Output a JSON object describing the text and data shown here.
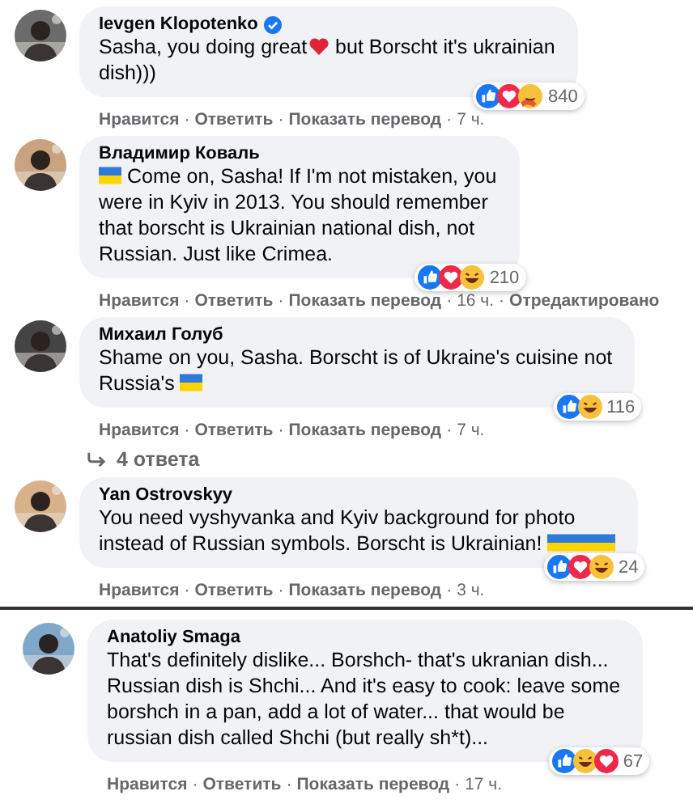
{
  "separator": "·",
  "comments": [
    {
      "author": "Ievgen Klopotenko",
      "verified": true,
      "lines": [
        [
          {
            "kind": "text",
            "text": "Sasha, you doing great"
          },
          {
            "kind": "heart"
          },
          {
            "kind": "text",
            "text": " but Borscht it's ukrainian"
          }
        ],
        [
          {
            "kind": "text",
            "text": "dish)))"
          }
        ]
      ],
      "actions": [
        "Нравится",
        "Ответить",
        "Показать перевод"
      ],
      "time": "7 ч.",
      "reactions": [
        {
          "kind": "like"
        },
        {
          "kind": "love"
        },
        {
          "kind": "care"
        }
      ],
      "reaction_count": "840"
    },
    {
      "author": "Владимир Коваль",
      "verified": false,
      "lines": [
        [
          {
            "kind": "flag"
          },
          {
            "kind": "text",
            "text": " Come on, Sasha! If I'm not mistaken, you"
          }
        ],
        [
          {
            "kind": "text",
            "text": "were in Kyiv in 2013. You should remember"
          }
        ],
        [
          {
            "kind": "text",
            "text": "that borscht is Ukrainian national dish, not"
          }
        ],
        [
          {
            "kind": "text",
            "text": "Russian. Just like Crimea."
          }
        ]
      ],
      "actions": [
        "Нравится",
        "Ответить",
        "Показать перевод"
      ],
      "time": "16 ч.",
      "edited": "Отредактировано",
      "reactions": [
        {
          "kind": "like"
        },
        {
          "kind": "love"
        },
        {
          "kind": "haha"
        }
      ],
      "reaction_count": "210"
    },
    {
      "author": "Михаил Голуб",
      "verified": false,
      "lines": [
        [
          {
            "kind": "text",
            "text": "Shame on you, Sasha. Borscht is of Ukraine's cuisine not"
          }
        ],
        [
          {
            "kind": "text",
            "text": "Russia's "
          },
          {
            "kind": "flag"
          }
        ]
      ],
      "actions": [
        "Нравится",
        "Ответить",
        "Показать перевод"
      ],
      "time": "7 ч.",
      "reactions": [
        {
          "kind": "like"
        },
        {
          "kind": "haha"
        }
      ],
      "reaction_count": "116",
      "replies": "4 ответа"
    },
    {
      "author": "Yan Ostrovskyy",
      "verified": false,
      "lines": [
        [
          {
            "kind": "text",
            "text": "You need vyshyvanka and Kyiv background for photo"
          }
        ],
        [
          {
            "kind": "text",
            "text": "instead of Russian symbols. Borscht is Ukrainian! "
          },
          {
            "kind": "flag"
          },
          {
            "kind": "flag"
          },
          {
            "kind": "flag"
          }
        ]
      ],
      "actions": [
        "Нравится",
        "Ответить",
        "Показать перевод"
      ],
      "time": "3 ч.",
      "reactions": [
        {
          "kind": "like"
        },
        {
          "kind": "love"
        },
        {
          "kind": "haha"
        }
      ],
      "reaction_count": "24"
    },
    {
      "author": "Anatoliy Smaga",
      "verified": false,
      "lines": [
        [
          {
            "kind": "text",
            "text": "That's definitely dislike... Borshch- that's ukranian dish..."
          }
        ],
        [
          {
            "kind": "text",
            "text": "Russian dish is Shchi... And it's easy to cook: leave some"
          }
        ],
        [
          {
            "kind": "text",
            "text": "borshch in a pan, add a lot of water... that would be"
          }
        ],
        [
          {
            "kind": "text",
            "text": "russian dish called Shchi (but really sh*t)..."
          }
        ]
      ],
      "actions": [
        "Нравится",
        "Ответить",
        "Показать перевод"
      ],
      "time": "17 ч.",
      "reactions": [
        {
          "kind": "like"
        },
        {
          "kind": "haha"
        },
        {
          "kind": "love"
        }
      ],
      "reaction_count": "67"
    }
  ]
}
